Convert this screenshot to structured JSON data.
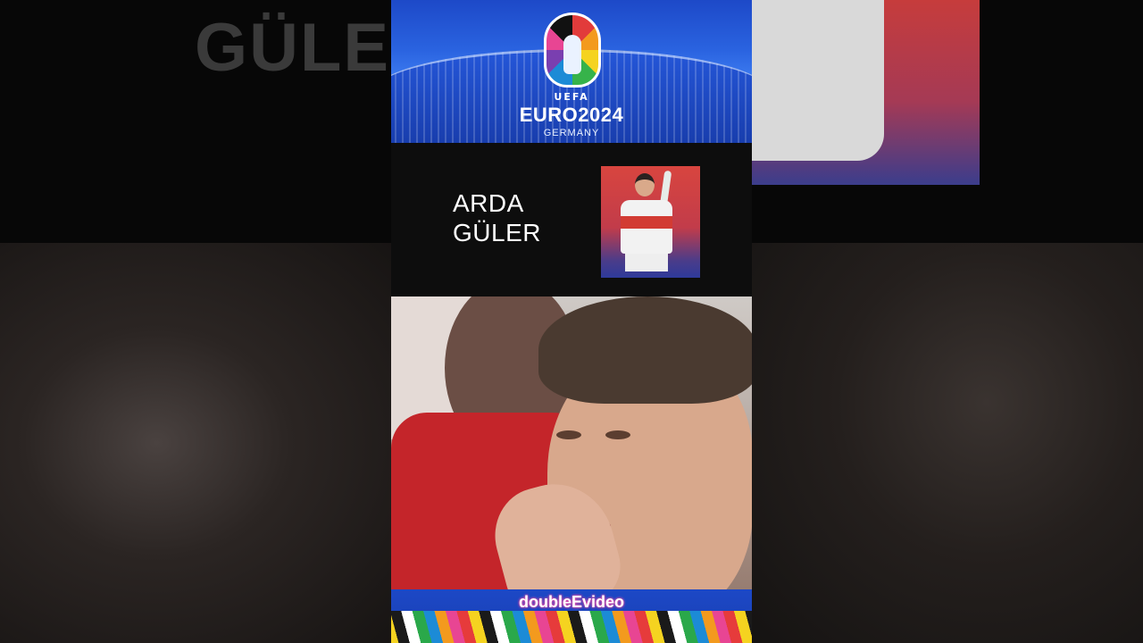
{
  "background": {
    "ghost_text": "GÜLE"
  },
  "banner": {
    "uefa": "UEFA",
    "title": "EURO2024",
    "subtitle": "GERMANY",
    "icon": "euro2024-trophy-logo-icon"
  },
  "player": {
    "first_name": "ARDA",
    "last_name": "GÜLER",
    "card_icon": "player-portrait-image"
  },
  "footer": {
    "watermark": "doubleEvideo"
  },
  "colors": {
    "banner_blue": "#2a63e0",
    "panel_black": "#0d0d0d",
    "shirt_red": "#c4252a"
  }
}
